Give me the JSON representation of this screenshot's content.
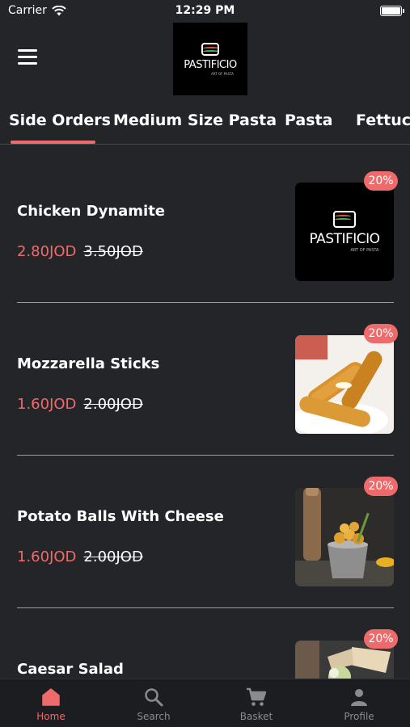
{
  "status_bar": {
    "carrier": "Carrier",
    "time": "12:29 PM"
  },
  "header": {
    "logo_text": "PASTIFICIO",
    "logo_sub": "ART OF PASTA"
  },
  "tabs": [
    {
      "label": "Side Orders",
      "active": true
    },
    {
      "label": "Medium Size Pasta",
      "active": false
    },
    {
      "label": "Pasta",
      "active": false
    },
    {
      "label": "Fettucc",
      "active": false
    }
  ],
  "items": [
    {
      "name": "Chicken Dynamite",
      "price": "2.80JOD",
      "old_price": "3.50JOD",
      "discount": "20%",
      "image": "pastificio-logo"
    },
    {
      "name": "Mozzarella Sticks",
      "price": "1.60JOD",
      "old_price": "2.00JOD",
      "discount": "20%",
      "image": "mozzarella-sticks-photo"
    },
    {
      "name": "Potato Balls With Cheese",
      "price": "1.60JOD",
      "old_price": "2.00JOD",
      "discount": "20%",
      "image": "potato-balls-photo"
    },
    {
      "name": "Caesar Salad",
      "price": "",
      "old_price": "",
      "discount": "20%",
      "image": "caesar-salad-photo"
    }
  ],
  "bottom_nav": [
    {
      "label": "Home",
      "icon": "home-icon",
      "active": true
    },
    {
      "label": "Search",
      "icon": "search-icon",
      "active": false
    },
    {
      "label": "Basket",
      "icon": "cart-icon",
      "active": false
    },
    {
      "label": "Profile",
      "icon": "profile-icon",
      "active": false
    }
  ],
  "colors": {
    "accent": "#ef6b6b",
    "background": "#242528",
    "nav_background": "#1c1d20"
  }
}
